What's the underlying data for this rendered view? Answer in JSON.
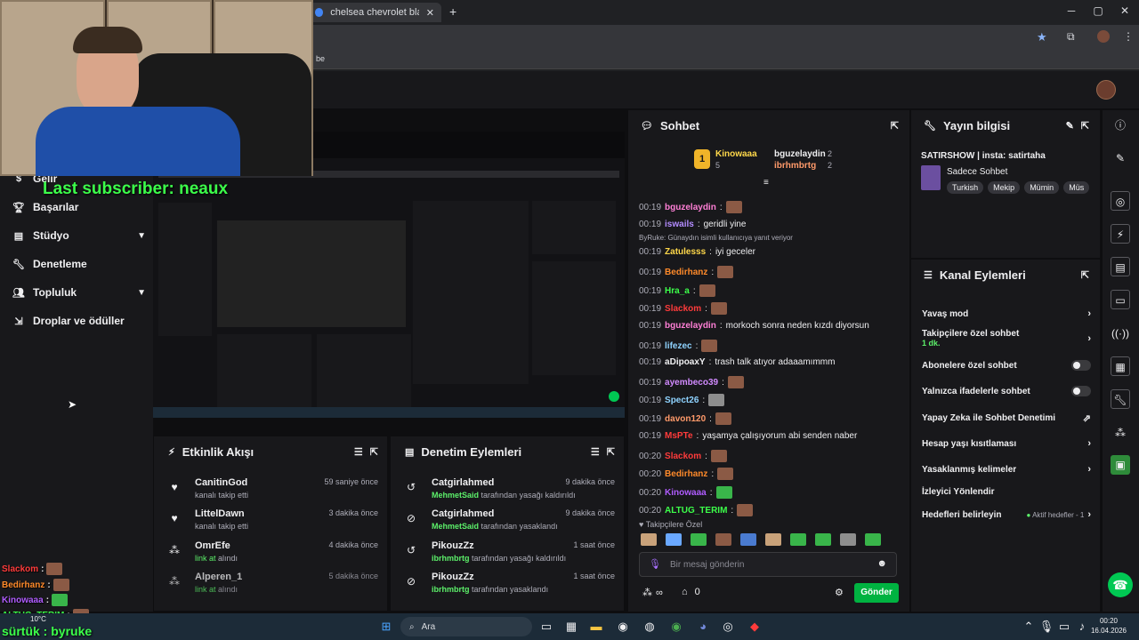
{
  "browser": {
    "tab_title": "chelsea chevrolet black kit - Go",
    "new_tab": "+",
    "bookmark_text": "be"
  },
  "left_nav": {
    "items": [
      {
        "label": "Gelir",
        "icon": "money-icon",
        "chevron": false
      },
      {
        "label": "Başarılar",
        "icon": "trophy-icon",
        "chevron": false
      },
      {
        "label": "Stüdyo",
        "icon": "studio-icon",
        "chevron": true
      },
      {
        "label": "Denetleme",
        "icon": "wrench-icon",
        "chevron": false
      },
      {
        "label": "Topluluk",
        "icon": "people-icon",
        "chevron": true
      },
      {
        "label": "Droplar ve ödüller",
        "icon": "gift-icon",
        "chevron": false
      }
    ]
  },
  "overlay": {
    "last_subscriber": "Last subscriber: neaux",
    "bottom_left_chat": [
      {
        "name": "Slackom",
        "color": "#ff3b3b"
      },
      {
        "name": "Bedirhanz",
        "color": "#ff8a2a"
      },
      {
        "name": "Kinowaaa",
        "color": "#b05cff"
      },
      {
        "name": "ALTUG_TERIM",
        "color": "#3cff4a"
      }
    ],
    "temp": "10°C",
    "subtitle": "sürtük : byruke"
  },
  "activity": {
    "title": "Etkinlik Akışı",
    "items": [
      {
        "icon": "heart-icon",
        "name": "CanitinGod",
        "sub": "kanalı takip etti",
        "time": "59 saniye önce"
      },
      {
        "icon": "heart-icon",
        "name": "LittelDawn",
        "sub": "kanalı takip etti",
        "time": "3 dakika önce"
      },
      {
        "icon": "points-icon",
        "name": "OmrEfe",
        "sub_hl": "link at",
        "sub": "alındı",
        "time": "4 dakika önce"
      },
      {
        "icon": "points-icon",
        "name": "Alperen_1",
        "sub_hl": "link at",
        "sub": "alındı",
        "time": "5 dakika önce"
      }
    ]
  },
  "mod_actions": {
    "title": "Denetim Eylemleri",
    "items": [
      {
        "icon": "undo-icon",
        "name": "Catgirlahmed",
        "actor": "MehmetSaid",
        "sub": "tarafından yasağı kaldırıldı",
        "time": "9 dakika önce"
      },
      {
        "icon": "ban-icon",
        "name": "Catgirlahmed",
        "actor": "MehmetSaid",
        "sub": "tarafından yasaklandı",
        "time": "9 dakika önce"
      },
      {
        "icon": "undo-icon",
        "name": "PikouzZz",
        "actor": "ibrhmbrtg",
        "sub": "tarafından yasağı kaldırıldı",
        "time": "1 saat önce"
      },
      {
        "icon": "ban-icon",
        "name": "PikouzZz",
        "actor": "ibrhmbrtg",
        "sub": "tarafından yasaklandı",
        "time": "1 saat önce"
      }
    ]
  },
  "chat": {
    "title": "Sohbet",
    "leaderboard": {
      "first": "Kinowaaa",
      "first_score": "5",
      "second": "bguzelaydin",
      "second_score": "2",
      "third": "ibrhmbrtg",
      "third_score": "2"
    },
    "reply_note": "ByRuke: Günaydın isimli kullanıcıya yanıt veriyor",
    "messages": [
      {
        "time": "00:19",
        "user": "bguzelaydin",
        "color": "#ff7fd6",
        "text": "",
        "emote": "brown"
      },
      {
        "time": "00:19",
        "user": "iswails",
        "color": "#b38cff",
        "text": "geridli yine",
        "emote": ""
      },
      {
        "time": "00:19",
        "user": "Zatulesss",
        "color": "#ffd84a",
        "text": "iyi geceler",
        "emote": ""
      },
      {
        "time": "00:19",
        "user": "Bedirhanz",
        "color": "#ff8a2a",
        "text": "",
        "emote": "brown"
      },
      {
        "time": "00:19",
        "user": "Hra_a",
        "color": "#3cff4a",
        "text": "",
        "emote": "brown"
      },
      {
        "time": "00:19",
        "user": "Slackom",
        "color": "#ff3b3b",
        "text": "",
        "emote": "brown"
      },
      {
        "time": "00:19",
        "user": "bguzelaydin",
        "color": "#ff7fd6",
        "text": "morkoch sonra neden kızdı diyorsun",
        "emote": ""
      },
      {
        "time": "00:19",
        "user": "lifezec",
        "color": "#8fd3ff",
        "text": "",
        "emote": "brown"
      },
      {
        "time": "00:19",
        "user": "aDipoaxY",
        "color": "#efeff1",
        "text": "trash talk atıyor adaaamımmm",
        "emote": ""
      },
      {
        "time": "00:19",
        "user": "ayembeco39",
        "color": "#d28bff",
        "text": "",
        "emote": "brown"
      },
      {
        "time": "00:19",
        "user": "Spect26",
        "color": "#8fd3ff",
        "text": "",
        "emote": "gray"
      },
      {
        "time": "00:19",
        "user": "davon120",
        "color": "#ff9a6a",
        "text": "",
        "emote": "brown"
      },
      {
        "time": "00:19",
        "user": "MsPTe",
        "color": "#ff3b3b",
        "text": "yaşamya çalışıyorum abi senden naber",
        "emote": ""
      },
      {
        "time": "00:20",
        "user": "Slackom",
        "color": "#ff3b3b",
        "text": "",
        "emote": "brown"
      },
      {
        "time": "00:20",
        "user": "Bedirhanz",
        "color": "#ff8a2a",
        "text": "",
        "emote": "brown"
      },
      {
        "time": "00:20",
        "user": "Kinowaaa",
        "color": "#b05cff",
        "text": "",
        "emote": "green"
      },
      {
        "time": "00:20",
        "user": "ALTUG_TERIM",
        "color": "#3cff4a",
        "text": "",
        "emote": "brown"
      }
    ],
    "follower_label": "Takipçilere Özel",
    "input_placeholder": "Bir mesaj gönderin",
    "points": "∞",
    "drops": "0",
    "send_label": "Gönder"
  },
  "stream_info": {
    "title": "Yayın bilgisi",
    "stream_title": "SATIRSHOW | insta: satirtaha",
    "category": "Sadece Sohbet",
    "tags": [
      "Turkish",
      "Mekip",
      "Mümin",
      "Müs"
    ]
  },
  "channel_actions": {
    "title": "Kanal Eylemleri",
    "items": [
      {
        "label": "Yavaş mod",
        "control": "chevron",
        "sub": ""
      },
      {
        "label": "Takipçilere özel sohbet",
        "control": "chevron",
        "sub": "1 dk."
      },
      {
        "label": "Abonelere özel sohbet",
        "control": "toggle",
        "sub": ""
      },
      {
        "label": "Yalnızca ifadelerle sohbet",
        "control": "toggle",
        "sub": ""
      },
      {
        "label": "Yapay Zeka ile Sohbet Denetimi",
        "control": "external",
        "sub": ""
      },
      {
        "label": "Hesap yaşı kısıtlaması",
        "control": "chevron",
        "sub": ""
      },
      {
        "label": "Yasaklanmış kelimeler",
        "control": "chevron",
        "sub": ""
      },
      {
        "label": "İzleyici Yönlendir",
        "control": "none",
        "sub": ""
      },
      {
        "label": "Hedefleri belirleyin",
        "control": "chevron",
        "sub": ""
      }
    ],
    "goals_status": "Aktif hedefler - 1"
  },
  "taskbar": {
    "search": "Ara",
    "time": "00:20",
    "date": "16.04.2026"
  },
  "colors": {
    "accent": "#00c853",
    "panel": "#18181b",
    "bg": "#0e0e10",
    "twitch_green": "#00b341"
  }
}
